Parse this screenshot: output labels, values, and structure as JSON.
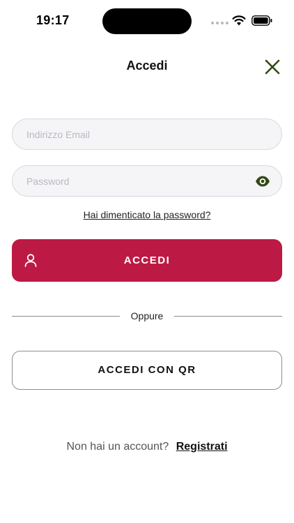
{
  "status_bar": {
    "time": "19:17"
  },
  "header": {
    "title": "Accedi",
    "close_icon": "close-icon",
    "close_color": "#2f4a12"
  },
  "form": {
    "email_placeholder": "Indirizzo Email",
    "email_value": "",
    "password_placeholder": "Password",
    "password_value": "",
    "password_toggle_icon": "eye-icon",
    "forgot_password": "Hai dimenticato la password?"
  },
  "login_button": {
    "label": "ACCEDI",
    "icon": "user-icon",
    "color": "#bc1a45"
  },
  "divider": {
    "label": "Oppure"
  },
  "qr_button": {
    "label": "ACCEDI CON QR"
  },
  "register": {
    "prompt": "Non hai un account?",
    "link": "Registrati"
  }
}
